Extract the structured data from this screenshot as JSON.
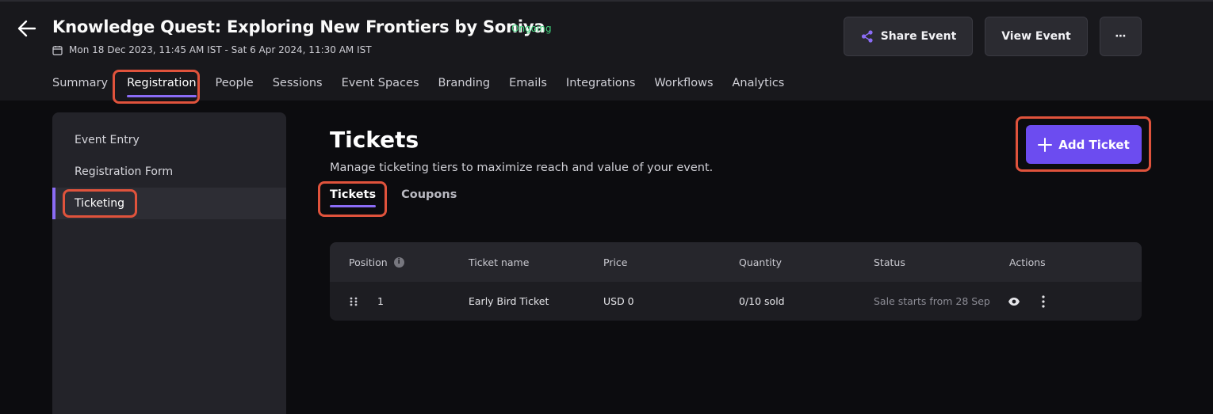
{
  "header": {
    "title": "Knowledge Quest: Exploring New Frontiers by Soniya",
    "status_badge": "Ongoing",
    "date_range": "Mon 18 Dec 2023, 11:45 AM IST - Sat 6 Apr 2024, 11:30 AM IST",
    "share_label": "Share Event",
    "view_label": "View Event",
    "more_label": "⋯"
  },
  "nav": {
    "tabs": [
      {
        "label": "Summary"
      },
      {
        "label": "Registration"
      },
      {
        "label": "People"
      },
      {
        "label": "Sessions"
      },
      {
        "label": "Event Spaces"
      },
      {
        "label": "Branding"
      },
      {
        "label": "Emails"
      },
      {
        "label": "Integrations"
      },
      {
        "label": "Workflows"
      },
      {
        "label": "Analytics"
      }
    ],
    "active": "Registration"
  },
  "sidebar": {
    "items": [
      {
        "label": "Event Entry"
      },
      {
        "label": "Registration Form"
      },
      {
        "label": "Ticketing"
      }
    ],
    "active": "Ticketing"
  },
  "main": {
    "title": "Tickets",
    "subtitle": "Manage ticketing tiers to maximize reach and value of your event.",
    "add_button": "Add Ticket",
    "subtabs": [
      {
        "label": "Tickets"
      },
      {
        "label": "Coupons"
      }
    ]
  },
  "table": {
    "columns": [
      "Position",
      "Ticket name",
      "Price",
      "Quantity",
      "Status",
      "Actions"
    ],
    "info_glyph": "i",
    "rows": [
      {
        "position": "1",
        "ticket_name": "Early Bird Ticket",
        "price": "USD 0",
        "quantity": "0/10 sold",
        "status": "Sale starts from 28 Sep"
      }
    ]
  },
  "colors": {
    "accent": "#8b6cf6",
    "primary_button": "#6c4cf0",
    "status_green": "#3ecf7a",
    "highlight_box": "#e0533c"
  }
}
